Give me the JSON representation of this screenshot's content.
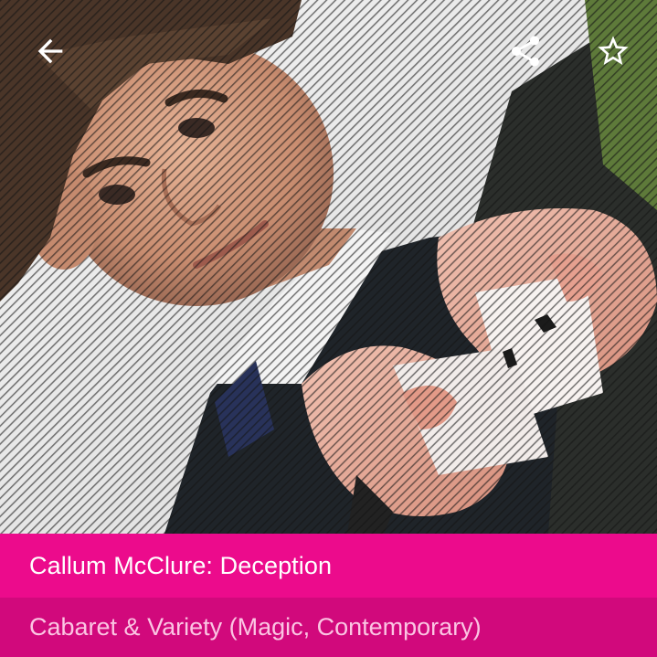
{
  "header": {
    "back_icon": "arrow-back-icon",
    "share_icon": "share-icon",
    "favorite_icon": "star-outline-icon"
  },
  "event": {
    "title": "Callum McClure: Deception",
    "category": "Cabaret & Variety (Magic, Contemporary)"
  },
  "colors": {
    "title_bar": "#ec0b8c",
    "category_bar": "#d1097c",
    "category_text": "#fbc5e3",
    "icon": "#ffffff"
  }
}
